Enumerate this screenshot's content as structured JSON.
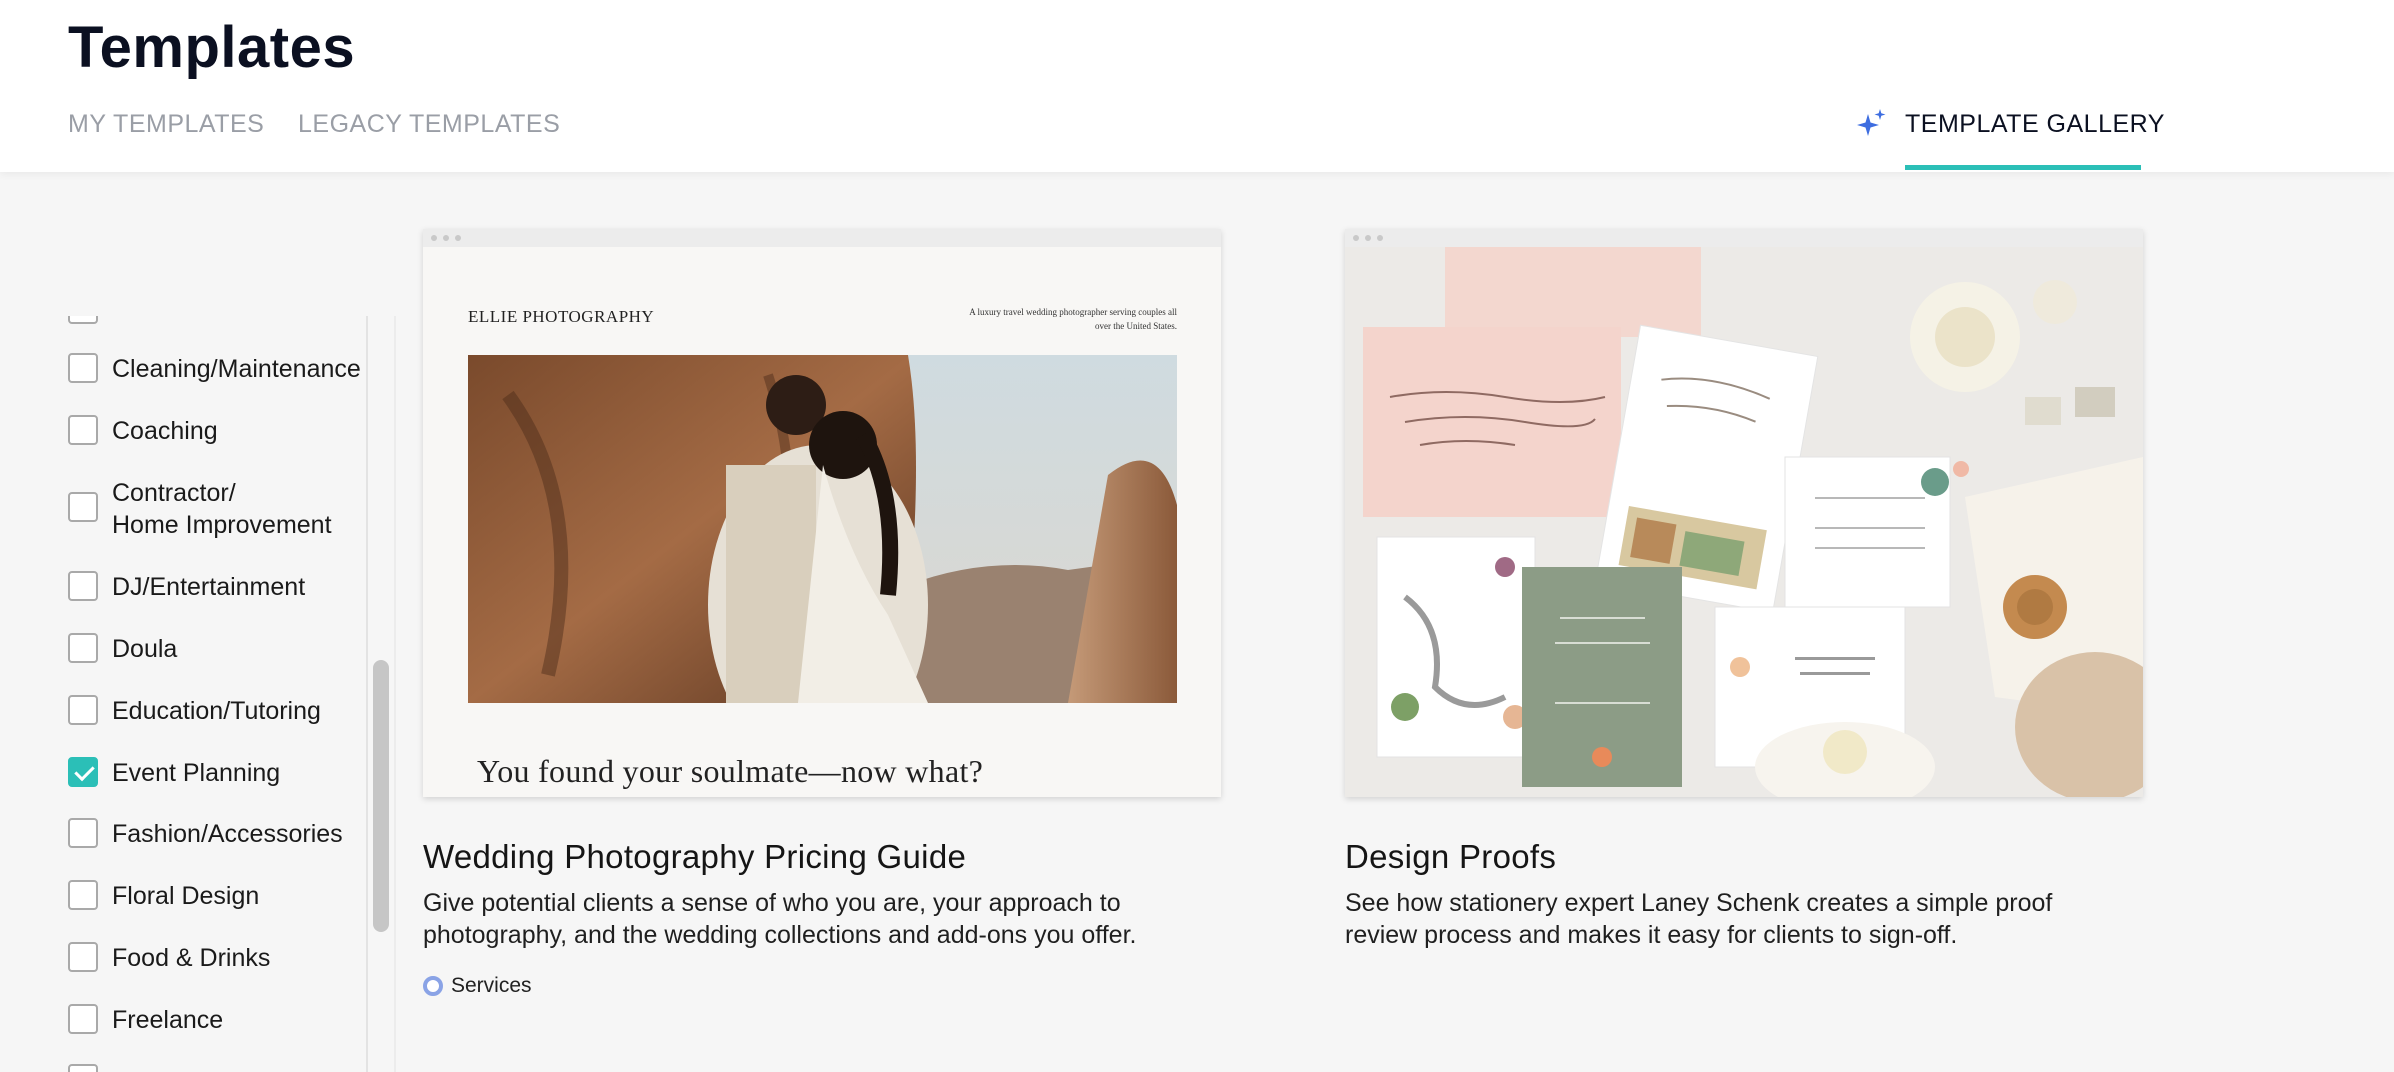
{
  "header": {
    "title": "Templates",
    "tabs": {
      "my_templates": "MY TEMPLATES",
      "legacy_templates": "LEGACY TEMPLATES",
      "template_gallery": "TEMPLATE GALLERY"
    },
    "active_tab": "template_gallery"
  },
  "sidebar": {
    "categories": [
      {
        "label": "Cleaning/Maintenance",
        "checked": false
      },
      {
        "label": "Coaching",
        "checked": false
      },
      {
        "label": "Contractor/\nHome Improvement",
        "checked": false
      },
      {
        "label": "DJ/Entertainment",
        "checked": false
      },
      {
        "label": "Doula",
        "checked": false
      },
      {
        "label": "Education/Tutoring",
        "checked": false
      },
      {
        "label": "Event Planning",
        "checked": true
      },
      {
        "label": "Fashion/Accessories",
        "checked": false
      },
      {
        "label": "Floral Design",
        "checked": false
      },
      {
        "label": "Food & Drinks",
        "checked": false
      },
      {
        "label": "Freelance",
        "checked": false
      }
    ]
  },
  "cards": [
    {
      "title": "Wedding Photography Pricing Guide",
      "description": "Give potential clients a sense of who you are, your approach to photography, and the wedding collections and add-ons you offer.",
      "tag": "Services",
      "preview": {
        "brand": "ELLIE PHOTOGRAPHY",
        "tagline": "A luxury travel wedding photographer serving couples all over the United States.",
        "headline": "You found your soulmate—now what?"
      }
    },
    {
      "title": "Design Proofs",
      "description": "See how stationery expert Laney Schenk creates a simple proof review process and makes it easy for clients to sign-off."
    }
  ],
  "colors": {
    "accent": "#2bbfb7",
    "tag_ring": "#8aa3e6",
    "sparkle": "#3d6de0"
  },
  "icons": {
    "gallery_tab": "sparkle-icon",
    "checkbox_checked": "checkmark-icon"
  }
}
